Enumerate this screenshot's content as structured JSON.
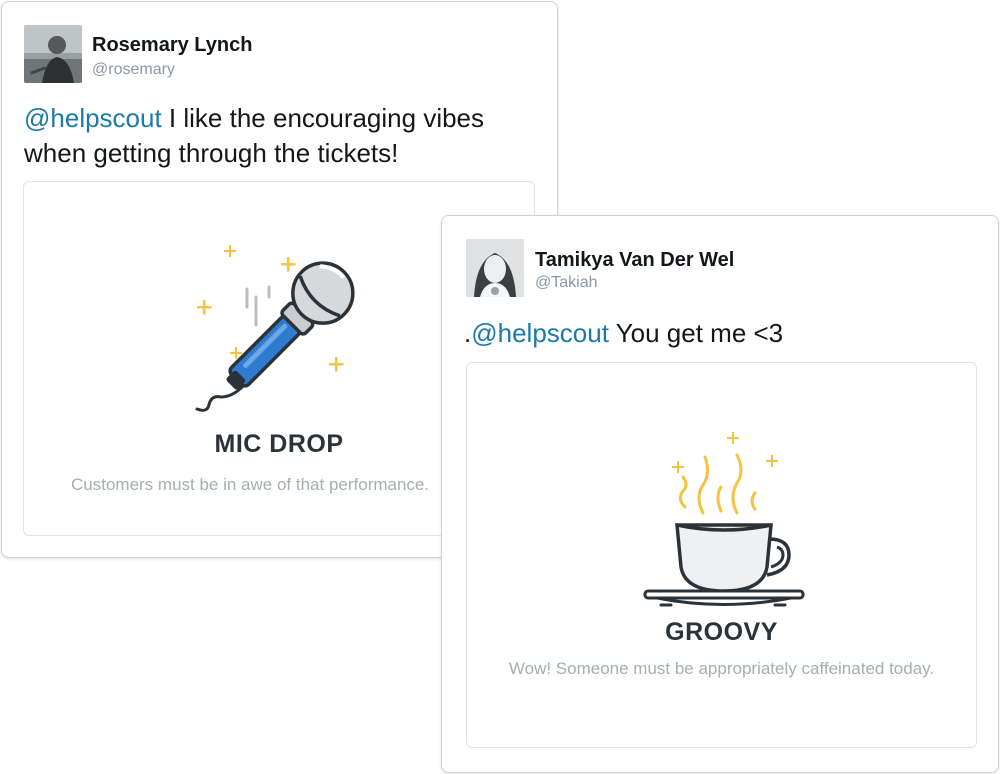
{
  "tweets": [
    {
      "author_name": "Rosemary Lynch",
      "author_handle": "@rosemary",
      "mention": "@helpscout",
      "text": " I like the encouraging vibes when getting through the tickets!",
      "card": {
        "icon": "microphone-icon",
        "title": "MIC DROP",
        "subtitle": "Customers must be in awe of that performance."
      }
    },
    {
      "author_name": "Tamikya Van Der Wel",
      "author_handle": "@Takiah",
      "prefix": ".",
      "mention": "@helpscout",
      "text": " You get me <3",
      "card": {
        "icon": "coffee-cup-icon",
        "title": "GROOVY",
        "subtitle": "Wow! Someone must be appropriately caffeinated today."
      }
    }
  ],
  "colors": {
    "mention": "#1b7aa8",
    "sparkle": "#f5c342",
    "mic_handle": "#2f7bd0",
    "card_title": "#2b3238",
    "card_subtitle": "#a6adb3"
  }
}
